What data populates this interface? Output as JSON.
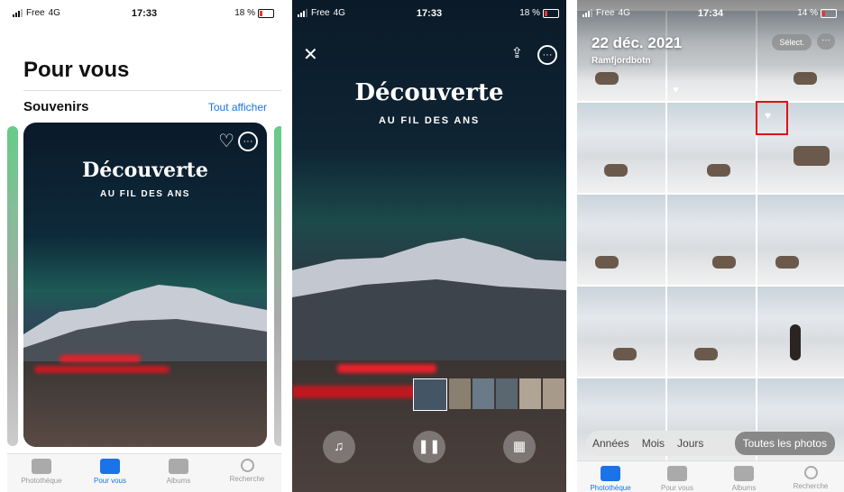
{
  "panel1": {
    "status": {
      "carrier": "Free",
      "network": "4G",
      "time": "17:33",
      "battery": "18 %"
    },
    "title": "Pour vous",
    "section_title": "Souvenirs",
    "see_all": "Tout afficher",
    "memory": {
      "title": "Découverte",
      "subtitle": "AU FIL DES ANS"
    },
    "tabs": [
      {
        "label": "Photothèque",
        "icon": "photos-icon"
      },
      {
        "label": "Pour vous",
        "icon": "for-you-icon"
      },
      {
        "label": "Albums",
        "icon": "albums-icon"
      },
      {
        "label": "Recherche",
        "icon": "search-icon"
      }
    ],
    "active_tab": "Pour vous"
  },
  "panel2": {
    "status": {
      "carrier": "Free",
      "network": "4G",
      "time": "17:33",
      "battery": "18 %"
    },
    "close": "✕",
    "memory": {
      "title": "Découverte",
      "subtitle": "AU FIL DES ANS"
    }
  },
  "panel3": {
    "status": {
      "carrier": "Free",
      "network": "4G",
      "time": "17:34",
      "battery": "14 %"
    },
    "date": "22 déc. 2021",
    "place": "Ramfjordbotn",
    "select": "Sélect.",
    "segments": [
      "Années",
      "Mois",
      "Jours",
      "Toutes les photos"
    ],
    "active_segment": "Toutes les photos",
    "tabs": [
      {
        "label": "Photothèque",
        "icon": "photos-icon"
      },
      {
        "label": "Pour vous",
        "icon": "for-you-icon"
      },
      {
        "label": "Albums",
        "icon": "albums-icon"
      },
      {
        "label": "Recherche",
        "icon": "search-icon"
      }
    ],
    "active_tab": "Photothèque"
  },
  "colors": {
    "accent": "#1a73e8",
    "highlight_box": "#e01010",
    "battery_low": "#e33333"
  }
}
